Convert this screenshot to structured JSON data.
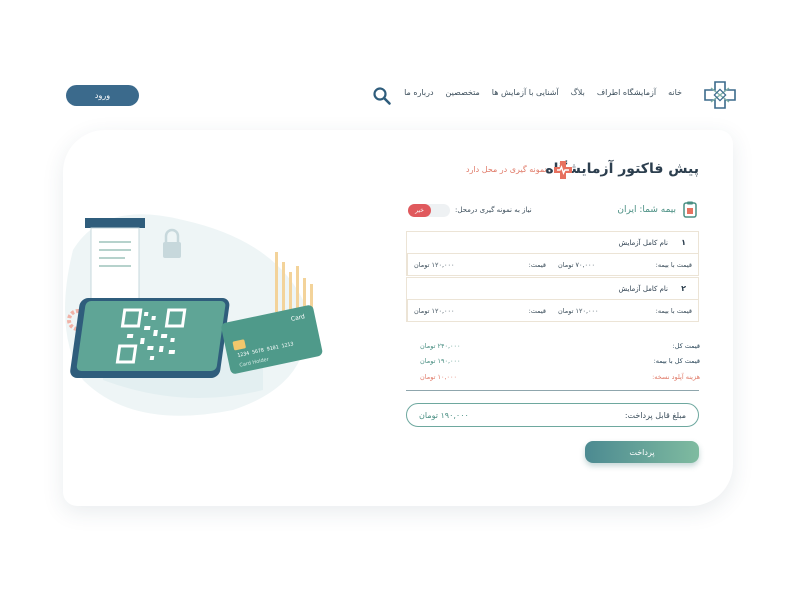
{
  "header": {
    "login_label": "ورود",
    "nav": [
      "خانه",
      "آزمایشگاه اطراف",
      "بلاگ",
      "آشنایی با آزمایش ها",
      "متخصصین",
      "درباره ما"
    ],
    "logo_icon": "medical-cross-logo-icon",
    "search_icon": "search-icon"
  },
  "invoice": {
    "title": "پیش فاکتور آزمایشگاه",
    "sampling_note": "نمونه گیری در محل دارد",
    "insurance": "بیمه شما: ایران",
    "need_sampling": "نیاز به نمونه گیری درمحل:",
    "toggle_label": "خیر"
  },
  "tests": [
    {
      "num": "۱",
      "name": "نام کامل آزمایش",
      "price_label": "قیمت:",
      "price": "۱۲۰,۰۰۰ تومان",
      "ins_label": "قیمت با بیمه:",
      "ins_price": "۷۰,۰۰۰ تومان"
    },
    {
      "num": "۲",
      "name": "نام کامل آزمایش",
      "price_label": "قیمت:",
      "price": "۱۲۰,۰۰۰ تومان",
      "ins_label": "قیمت با بیمه:",
      "ins_price": "۱۲۰,۰۰۰ تومان"
    }
  ],
  "summary": {
    "total_label": "قیمت کل:",
    "total": "۲۴۰,۰۰۰ تومان",
    "total_ins_label": "قیمت کل با بیمه:",
    "total_ins": "۱۹۰,۰۰۰ تومان",
    "fee_label": "هزینه آپلود نسخه:",
    "fee": "۱۰,۰۰۰ تومان",
    "payable_label": "مبلغ قابل پرداخت:",
    "payable": "۱۹۰,۰۰۰ تومان"
  },
  "pay_label": "پرداخت",
  "illustration": {
    "card_label": "Card",
    "card_number": "1234 5678 9101 1213",
    "card_holder": "Card Holder"
  },
  "colors": {
    "accent": "#3b6a8c",
    "teal": "#4a8f83",
    "coral": "#e07a68",
    "red": "#e0595d"
  }
}
